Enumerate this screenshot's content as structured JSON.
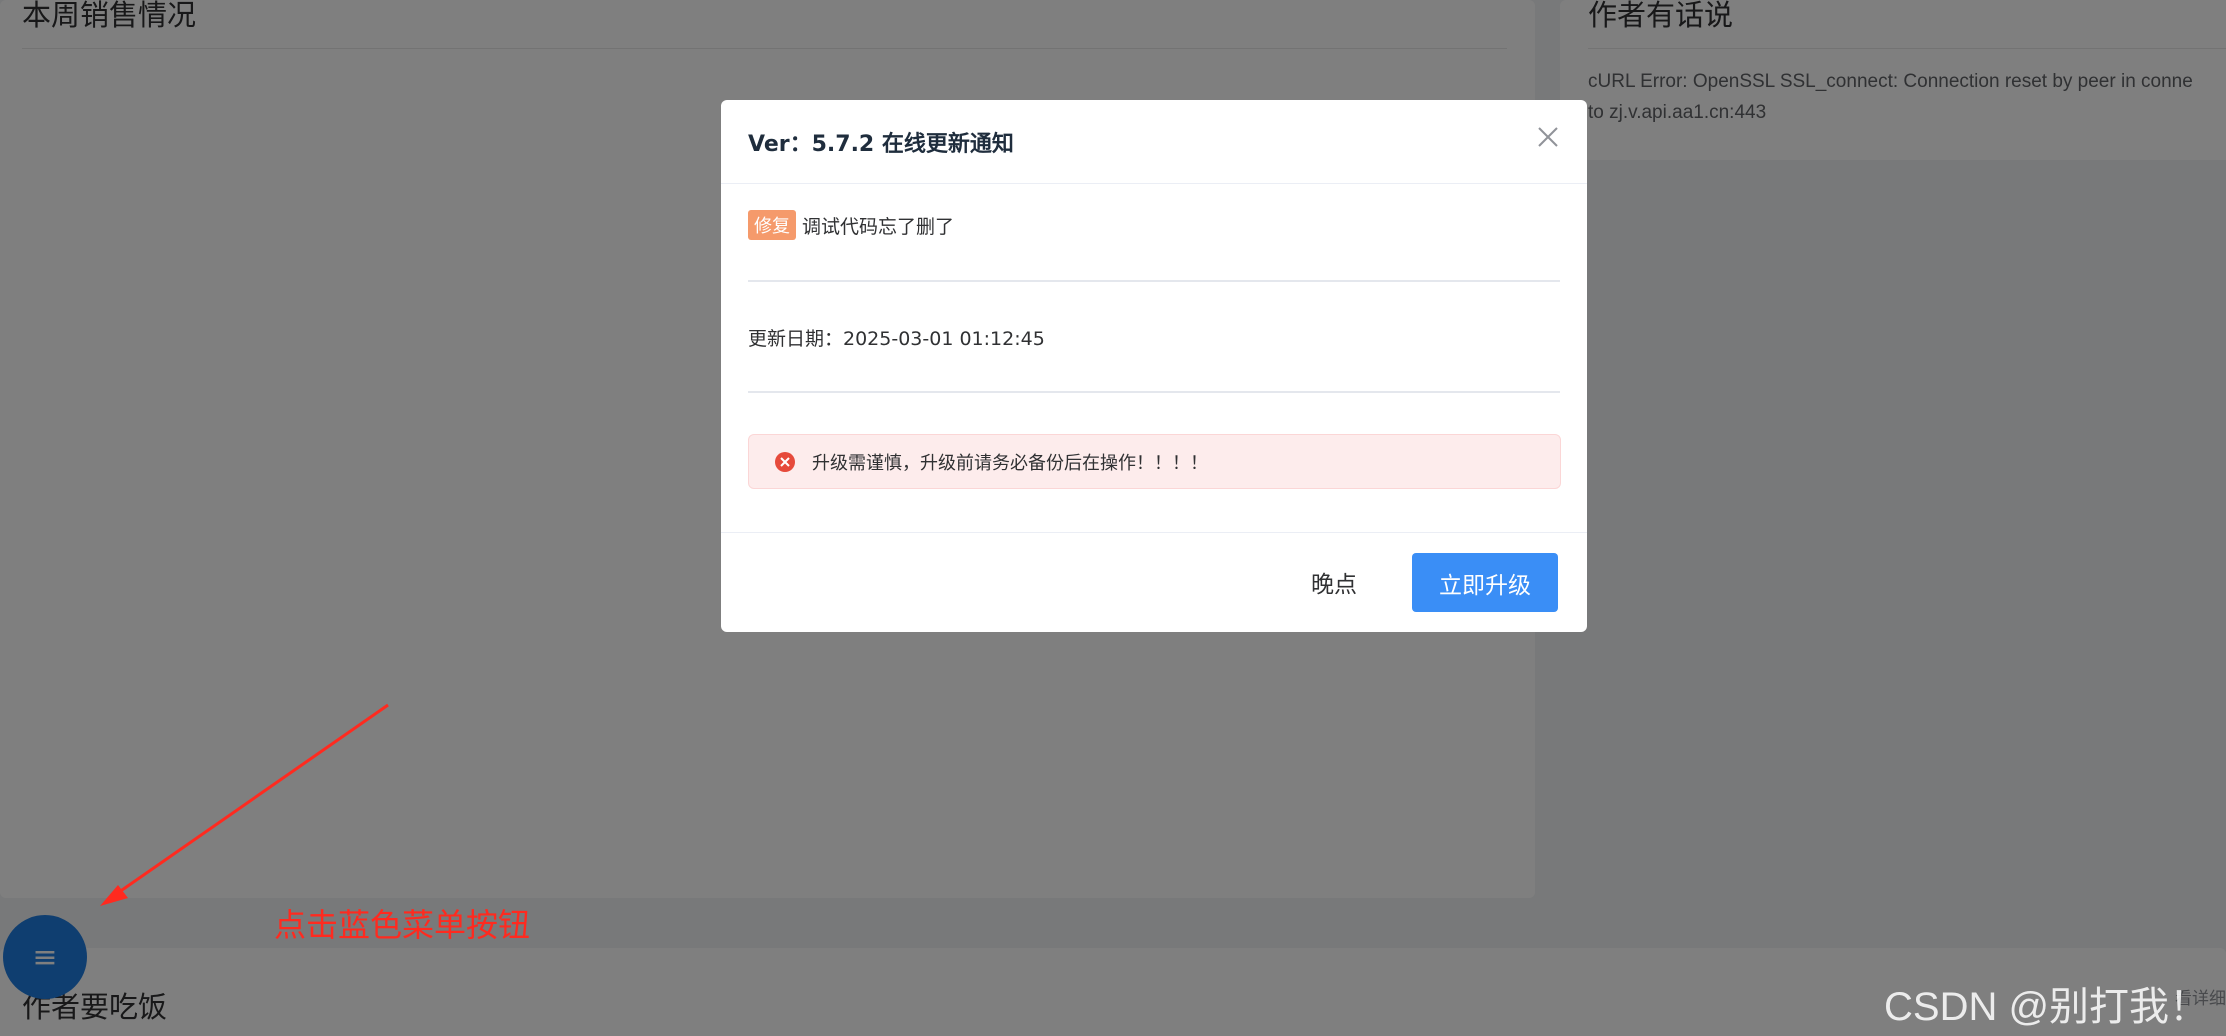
{
  "background": {
    "sales_card": {
      "title": "本周销售情况"
    },
    "author_card": {
      "title": "作者有话说",
      "message_line1": "cURL Error: OpenSSL SSL_connect: Connection reset by peer in conne",
      "message_line2": "to zj.v.api.aa1.cn:443"
    },
    "eat_card": {
      "title": "作者要吃饭",
      "more": "看详细"
    },
    "fab": {
      "icon": "menu-icon",
      "glyph": "≡"
    }
  },
  "annotation": {
    "text": "点击蓝色菜单按钮",
    "color": "#ff2a1f"
  },
  "watermark": "CSDN @别打我！",
  "dialog": {
    "title": "Ver：5.7.2 在线更新通知",
    "change": {
      "tag": "修复",
      "text": "调试代码忘了删了"
    },
    "date": "更新日期：2025-03-01 01:12:45",
    "alert": {
      "icon": "error-circle-icon",
      "text": "升级需谨慎，升级前请务必备份后在操作！！！！"
    },
    "buttons": {
      "later": "晚点",
      "upgrade": "立即升级"
    }
  },
  "colors": {
    "primary": "#3a8ef6",
    "fab": "#1e7ce0",
    "tag": "#f59a6b",
    "alert_bg": "#fdecec",
    "alert_icon": "#e64a3b"
  }
}
